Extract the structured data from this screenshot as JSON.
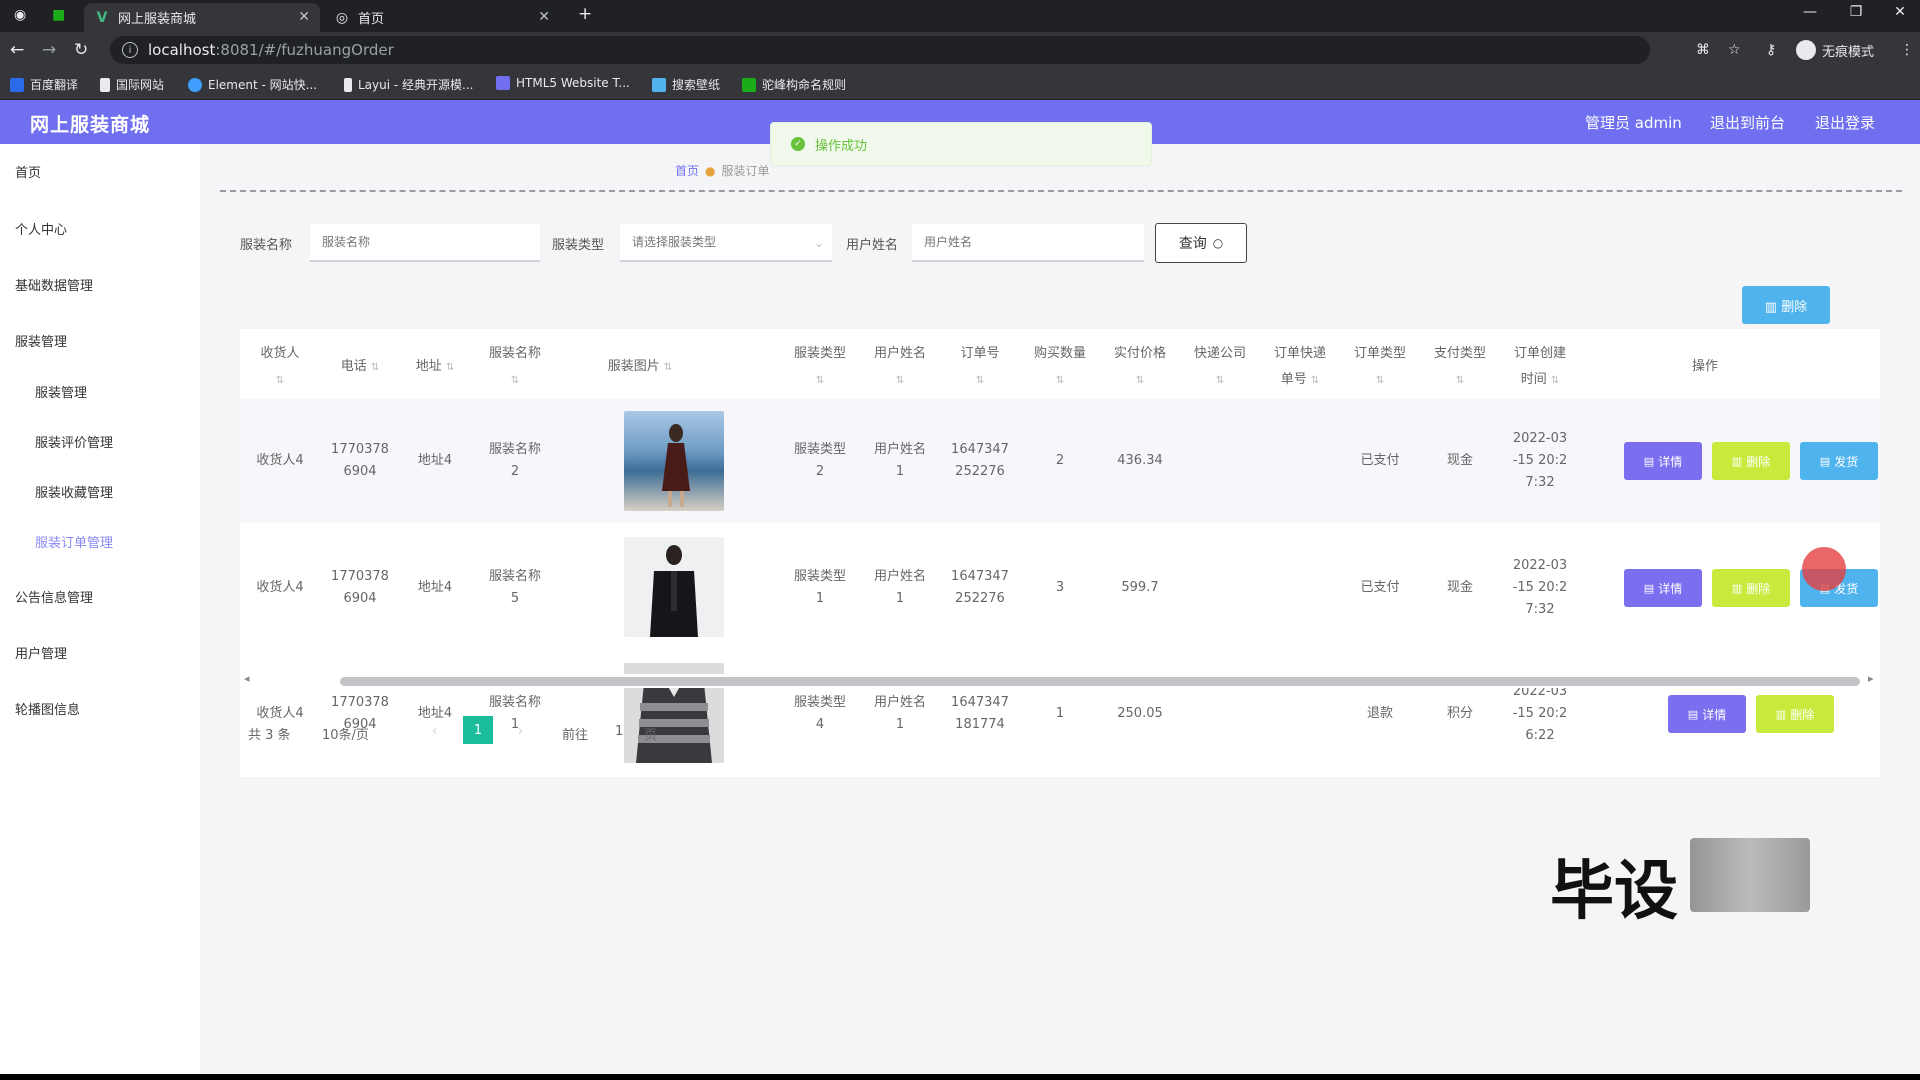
{
  "browser": {
    "tabs": [
      {
        "title": "网上服装商城"
      },
      {
        "title": "首页"
      }
    ],
    "new_tab": "+",
    "url_host": "localhost",
    "url_path": ":8081/#/fuzhuangOrder",
    "incognito_label": "无痕模式",
    "bookmarks": [
      {
        "label": "百度翻译",
        "color": "#2b6ae8"
      },
      {
        "label": "国际网站",
        "color": "#e8eaed"
      },
      {
        "label": "Element - 网站快...",
        "color": "#409eff"
      },
      {
        "label": "Layui - 经典开源模...",
        "color": "#e8eaed"
      },
      {
        "label": "HTML5 Website T...",
        "color": "#6f6ff0"
      },
      {
        "label": "搜索壁纸",
        "color": "#4fb4ee"
      },
      {
        "label": "驼峰构命名规则",
        "color": "#1aad19"
      }
    ]
  },
  "header": {
    "brand": "网上服装商城",
    "admin": "管理员 admin",
    "to_front": "退出到前台",
    "logout": "退出登录"
  },
  "toast": {
    "text": "操作成功"
  },
  "sidebar": {
    "items": [
      {
        "label": "首页"
      },
      {
        "label": "个人中心"
      },
      {
        "label": "基础数据管理"
      },
      {
        "label": "服装管理"
      },
      {
        "label": "公告信息管理"
      },
      {
        "label": "用户管理"
      },
      {
        "label": "轮播图信息"
      }
    ],
    "subitems": [
      {
        "label": "服装管理"
      },
      {
        "label": "服装评价管理"
      },
      {
        "label": "服装收藏管理"
      },
      {
        "label": "服装订单管理"
      }
    ]
  },
  "breadcrumb": {
    "home": "首页",
    "current": "服装订单"
  },
  "search": {
    "name_label": "服装名称",
    "name_placeholder": "服装名称",
    "type_label": "服装类型",
    "type_placeholder": "请选择服装类型",
    "user_label": "用户姓名",
    "user_placeholder": "用户姓名",
    "query_label": "查询"
  },
  "batch_delete_label": "删除",
  "table": {
    "headers": [
      {
        "l1": "收货人",
        "l2": ""
      },
      {
        "l1": "电话",
        "l2": ""
      },
      {
        "l1": "地址",
        "l2": ""
      },
      {
        "l1": "服装名称",
        "l2": ""
      },
      {
        "l1": "服装图片",
        "l2": ""
      },
      {
        "l1": "服装类型",
        "l2": ""
      },
      {
        "l1": "用户姓名",
        "l2": ""
      },
      {
        "l1": "订单号",
        "l2": ""
      },
      {
        "l1": "购买数量",
        "l2": ""
      },
      {
        "l1": "实付价格",
        "l2": ""
      },
      {
        "l1": "快递公司",
        "l2": ""
      },
      {
        "l1": "订单快递",
        "l2": "单号"
      },
      {
        "l1": "订单类型",
        "l2": ""
      },
      {
        "l1": "支付类型",
        "l2": ""
      },
      {
        "l1": "订单创建",
        "l2": "时间"
      },
      {
        "l1": "操作",
        "l2": ""
      }
    ],
    "sort_glyph": "⇅",
    "rows": [
      {
        "receiver": "收货人4",
        "phone_l1": "1770378",
        "phone_l2": "6904",
        "address": "地址4",
        "name_l1": "服装名称",
        "name_l2": "2",
        "type_l1": "服装类型",
        "type_l2": "2",
        "user_l1": "用户姓名",
        "user_l2": "1",
        "order_l1": "1647347",
        "order_l2": "252276",
        "qty": "2",
        "price": "436.34",
        "courier": "",
        "tracking": "",
        "status": "已支付",
        "pay": "现金",
        "time_l1": "2022-03",
        "time_l2": "-15 20:2",
        "time_l3": "7:32",
        "buttons": {
          "detail": "详情",
          "del": "删除",
          "ship": "发货"
        }
      },
      {
        "receiver": "收货人4",
        "phone_l1": "1770378",
        "phone_l2": "6904",
        "address": "地址4",
        "name_l1": "服装名称",
        "name_l2": "5",
        "type_l1": "服装类型",
        "type_l2": "1",
        "user_l1": "用户姓名",
        "user_l2": "1",
        "order_l1": "1647347",
        "order_l2": "252276",
        "qty": "3",
        "price": "599.7",
        "courier": "",
        "tracking": "",
        "status": "已支付",
        "pay": "现金",
        "time_l1": "2022-03",
        "time_l2": "-15 20:2",
        "time_l3": "7:32",
        "buttons": {
          "detail": "详情",
          "del": "删除",
          "ship": "发货"
        }
      },
      {
        "receiver": "收货人4",
        "phone_l1": "1770378",
        "phone_l2": "6904",
        "address": "地址4",
        "name_l1": "服装名称",
        "name_l2": "1",
        "type_l1": "服装类型",
        "type_l2": "4",
        "user_l1": "用户姓名",
        "user_l2": "1",
        "order_l1": "1647347",
        "order_l2": "181774",
        "qty": "1",
        "price": "250.05",
        "courier": "",
        "tracking": "",
        "status": "退款",
        "pay": "积分",
        "time_l1": "2022-03",
        "time_l2": "-15 20:2",
        "time_l3": "6:22",
        "buttons": {
          "detail": "详情",
          "del": "删除"
        }
      }
    ]
  },
  "pagination": {
    "total": "共 3 条",
    "page_size": "10条/页",
    "prev": "‹",
    "current": "1",
    "next": "›",
    "goto": "前往",
    "goto_value": "1",
    "page_suffix": "页"
  },
  "watermark": {
    "text": "毕设"
  },
  "colors": {
    "header": "#6f6ff0",
    "detail_btn": "#7b6ff0",
    "delete_btn": "#c7ea3d",
    "ship_btn": "#4fb4ee",
    "page_active": "#1abc9c"
  }
}
